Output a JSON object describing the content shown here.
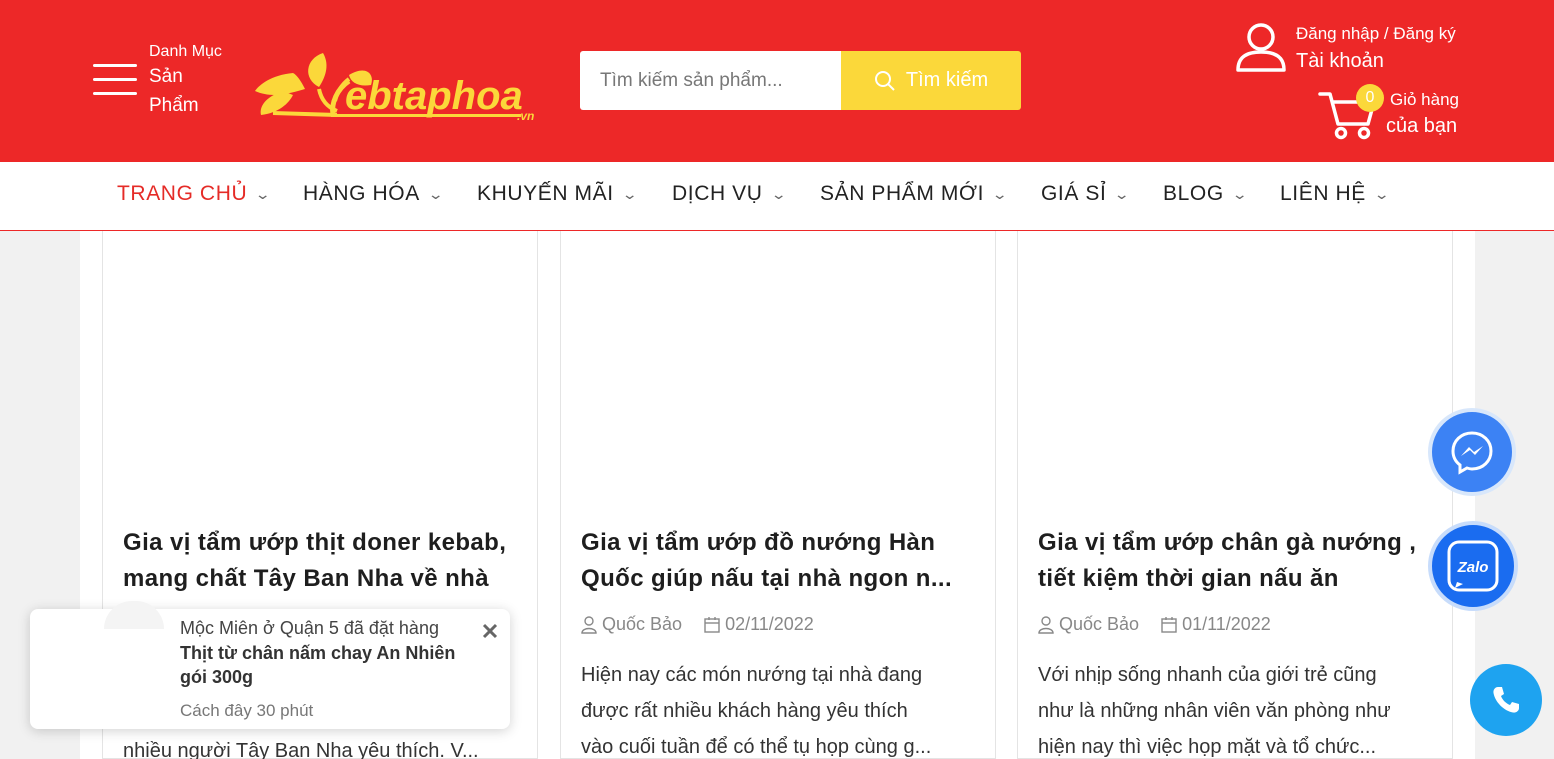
{
  "header": {
    "menu": {
      "line1": "Danh Mục",
      "line2": "Sản",
      "line3": "Phẩm"
    },
    "logo_text": "ebtaphoa",
    "logo_suffix": ".vn",
    "search": {
      "placeholder": "Tìm kiếm sản phẩm...",
      "button_label": "Tìm kiếm"
    },
    "account": {
      "login_label": "Đăng nhập / Đăng ký",
      "account_label": "Tài khoản"
    },
    "cart": {
      "count": "0",
      "line1": "Giỏ hàng",
      "line2": "của bạn"
    }
  },
  "nav": {
    "items": [
      {
        "label": "TRANG CHỦ",
        "active": true
      },
      {
        "label": "HÀNG HÓA"
      },
      {
        "label": "KHUYẾN MÃI"
      },
      {
        "label": "DỊCH VỤ"
      },
      {
        "label": "SẢN PHẨM MỚI"
      },
      {
        "label": "GIÁ SỈ"
      },
      {
        "label": "BLOG"
      },
      {
        "label": "LIÊN HỆ"
      }
    ]
  },
  "posts": [
    {
      "title_line1": "Gia vị tẩm ướp thịt doner kebab,",
      "title_line2": "mang chất Tây Ban Nha về nhà",
      "author": "",
      "date": "",
      "excerpt_line1": "",
      "excerpt_line2": "",
      "excerpt_line3": "nhiều người Tây Ban Nha yêu thích. V..."
    },
    {
      "title_line1": "Gia vị tẩm ướp đồ nướng Hàn",
      "title_line2": "Quốc giúp nấu tại nhà ngon n...",
      "author": "Quốc Bảo",
      "date": "02/11/2022",
      "excerpt_line1": "Hiện nay các món nướng tại nhà đang",
      "excerpt_line2": "được rất nhiều khách hàng yêu thích",
      "excerpt_line3": "vào cuối tuần để có thể tụ họp cùng g..."
    },
    {
      "title_line1": "Gia vị tẩm ướp chân gà nướng ,",
      "title_line2": "tiết kiệm thời gian nấu ăn",
      "author": "Quốc Bảo",
      "date": "01/11/2022",
      "excerpt_line1": "Với nhịp sống nhanh của giới trẻ cũng",
      "excerpt_line2": "như là những nhân viên văn phòng như",
      "excerpt_line3": "hiện nay thì việc họp mặt và tổ chức..."
    }
  ],
  "toast": {
    "line1": "Mộc Miên ở Quận 5 đã đặt hàng",
    "product_line1": "Thịt từ chân nấm chay An Nhiên",
    "product_line2": "gói 300g",
    "time": "Cách đây 30 phút"
  },
  "floating": {
    "messenger_icon": "messenger-icon",
    "zalo_label": "Zalo",
    "phone_icon": "phone-icon"
  },
  "colors": {
    "brand_red": "#ed2828",
    "accent_yellow": "#fbd83a",
    "nav_active": "#e52b27"
  }
}
